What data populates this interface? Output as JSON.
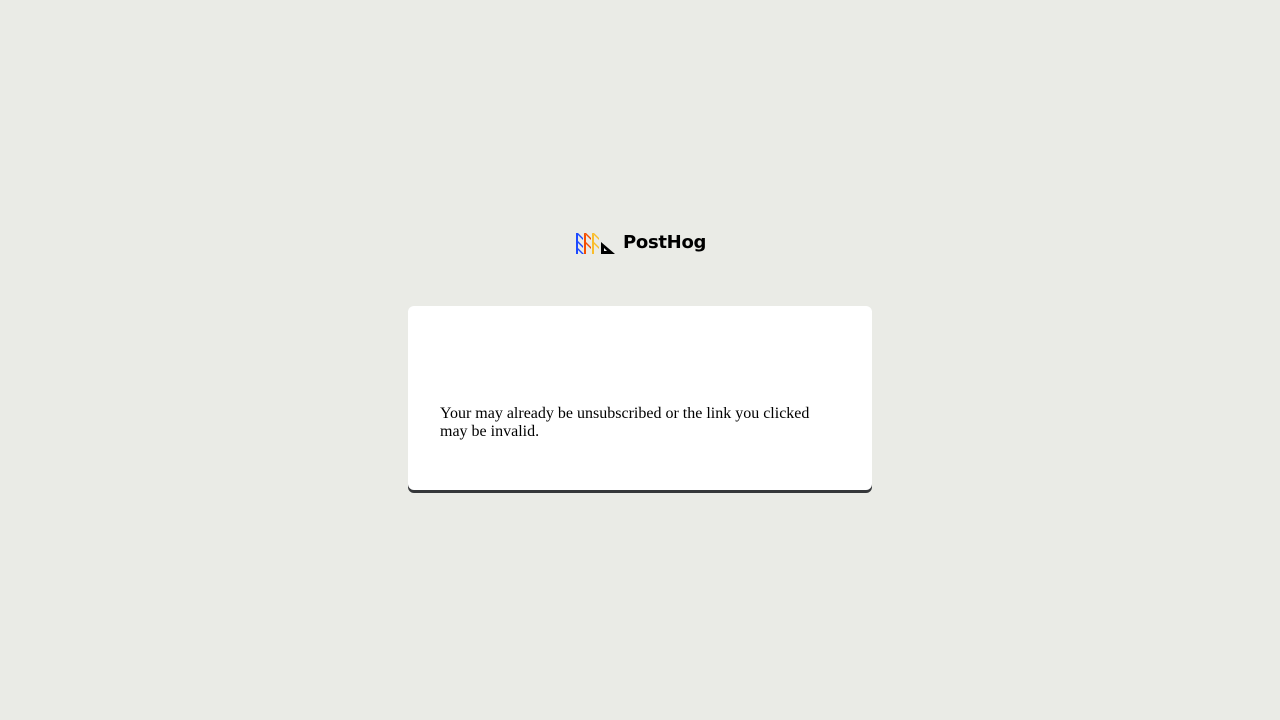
{
  "brand": {
    "name": "PostHog",
    "logo_icon": "posthog-hedgehog-logo",
    "colors": {
      "blue": "#1d4aff",
      "orange": "#f54e00",
      "yellow": "#f9bd2b",
      "black": "#000000"
    }
  },
  "page": {
    "background": "#eaebe6"
  },
  "card": {
    "message": "Your may already be unsubscribed or the link you clicked may be invalid."
  }
}
